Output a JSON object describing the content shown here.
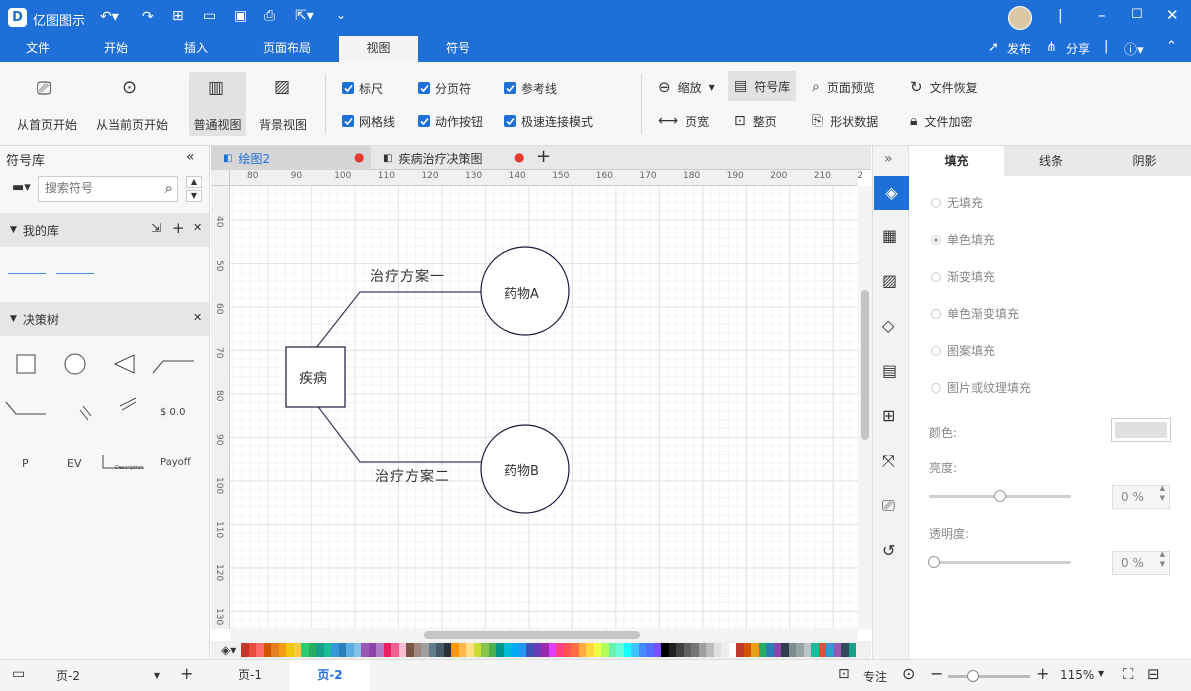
{
  "app": {
    "title": "亿图图示",
    "user_initials": ""
  },
  "menu_tabs": [
    "文件",
    "开始",
    "插入",
    "页面布局",
    "视图",
    "符号"
  ],
  "active_menu_tab": "视图",
  "header_actions": {
    "publish": "发布",
    "share": "分享"
  },
  "ribbon": {
    "start_first": "从首页开始",
    "start_current": "从当前页开始",
    "normal_view": "普通视图",
    "background_view": "背景视图",
    "checkboxes": [
      "标尺",
      "分页符",
      "参考线",
      "网格线",
      "动作按钮",
      "极速连接模式"
    ],
    "zoom": "缩放",
    "page_width": "页宽",
    "whole_page": "整页",
    "library": "符号库",
    "page_preview": "页面预览",
    "shape_data": "形状数据",
    "file_recover": "文件恢复",
    "file_encrypt": "文件加密"
  },
  "left_panel": {
    "title": "符号库",
    "search_placeholder": "搜索符号",
    "section_mine": "我的库",
    "section_decision": "决策树",
    "shape_labels": {
      "value": "$ 0.0",
      "p": "P",
      "ev": "EV",
      "desc": "Description",
      "payoff": "Payoff"
    }
  },
  "doc_tabs": [
    {
      "label": "绘图2",
      "active": true
    },
    {
      "label": "疾病治疗决策图",
      "active": false
    }
  ],
  "ruler": {
    "h_ticks": [
      "80",
      "90",
      "100",
      "110",
      "120",
      "130",
      "140",
      "150",
      "160",
      "170",
      "180",
      "190",
      "200",
      "210",
      "2"
    ],
    "v_ticks": [
      "40",
      "50",
      "60",
      "70",
      "80",
      "90",
      "100",
      "110",
      "120",
      "130"
    ]
  },
  "diagram": {
    "root": "疾病",
    "branch1_label": "治疗方案一",
    "branch2_label": "治疗方案二",
    "node1": "药物A",
    "node2": "药物B"
  },
  "right_panel": {
    "tabs": [
      "填充",
      "线条",
      "阴影"
    ],
    "fill_options": [
      "无填充",
      "单色填充",
      "渐变填充",
      "单色渐变填充",
      "图案填充",
      "图片或纹理填充"
    ],
    "selected_fill": "单色填充",
    "color_label": "颜色:",
    "brightness_label": "亮度:",
    "brightness_value": "0 %",
    "transparency_label": "透明度:",
    "transparency_value": "0 %"
  },
  "status": {
    "page_select": "页-2",
    "pages": [
      "页-1",
      "页-2"
    ],
    "active_page": "页-2",
    "focus": "专注",
    "zoom": "115%"
  },
  "colors": {
    "accent": "#1f6fd8",
    "palette": [
      "#c0392b",
      "#e74c3c",
      "#ff6b6b",
      "#d35400",
      "#e67e22",
      "#f39c12",
      "#f1c40f",
      "#f4d03f",
      "#2ecc71",
      "#27ae60",
      "#16a085",
      "#1abc9c",
      "#3498db",
      "#2980b9",
      "#5dade2",
      "#85c1e9",
      "#9b59b6",
      "#8e44ad",
      "#af7ac5",
      "#e91e63",
      "#f06292",
      "#f8bbd0",
      "#795548",
      "#a1887f",
      "#9e9e9e",
      "#607d8b",
      "#455a64",
      "#263238",
      "#ff9800",
      "#ffb74d",
      "#ffe082",
      "#cddc39",
      "#8bc34a",
      "#4caf50",
      "#009688",
      "#00bcd4",
      "#03a9f4",
      "#2196f3",
      "#3f51b5",
      "#673ab7",
      "#9c27b0",
      "#e040fb",
      "#ff4081",
      "#ff5252",
      "#ff6e40",
      "#ffab40",
      "#ffd740",
      "#eeff41",
      "#b2ff59",
      "#69f0ae",
      "#64ffda",
      "#18ffff",
      "#40c4ff",
      "#448aff",
      "#536dfe",
      "#7c4dff",
      "#000000",
      "#212121",
      "#424242",
      "#616161",
      "#757575",
      "#9e9e9e",
      "#bdbdbd",
      "#e0e0e0",
      "#eeeeee",
      "#ffffff",
      "#c0392b",
      "#d35400",
      "#f39c12",
      "#27ae60",
      "#2980b9",
      "#8e44ad",
      "#2c3e50",
      "#7f8c8d",
      "#95a5a6",
      "#bdc3c7",
      "#1abc9c",
      "#e74c3c",
      "#3498db",
      "#9b59b6",
      "#34495e",
      "#16a085"
    ]
  }
}
